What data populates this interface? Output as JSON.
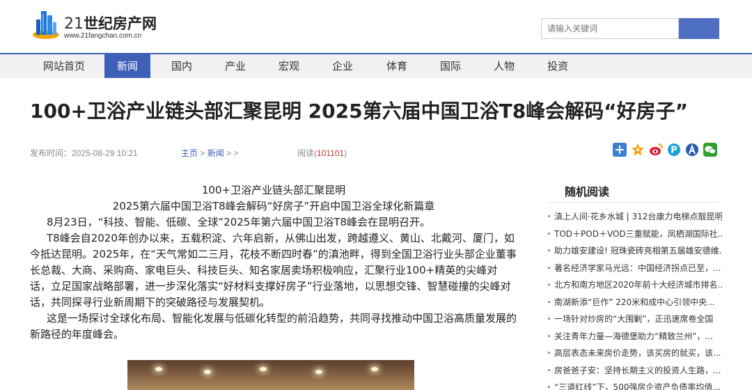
{
  "header": {
    "logo_num": "21",
    "logo_name": "世纪房产网",
    "logo_url": "www.21fangchan.com.cn",
    "search_placeholder": "请输入关键词",
    "brand_color": "#3d5fb8"
  },
  "nav": {
    "items": [
      {
        "label": "网站首页",
        "active": false
      },
      {
        "label": "新闻",
        "active": true
      },
      {
        "label": "国内",
        "active": false
      },
      {
        "label": "产业",
        "active": false
      },
      {
        "label": "宏观",
        "active": false
      },
      {
        "label": "企业",
        "active": false
      },
      {
        "label": "体育",
        "active": false
      },
      {
        "label": "国际",
        "active": false
      },
      {
        "label": "人物",
        "active": false
      },
      {
        "label": "投资",
        "active": false
      }
    ]
  },
  "article": {
    "title": "100+卫浴产业链头部汇聚昆明 2025第六届中国卫浴T8峰会解码“好房子”",
    "publish_label": "发布时间：2025-08-29 10:21",
    "breadcrumb_home": "主页",
    "breadcrumb_sep1": " > ",
    "breadcrumb_news": "新闻",
    "breadcrumb_sep2": " > >",
    "read_label": "阅读(",
    "read_count": "101101",
    "read_close": ")",
    "subtitle1": "100+卫浴产业链头部汇聚昆明",
    "subtitle2": "2025第六届中国卫浴T8峰会解码“好房子”开启中国卫浴全球化新篇章",
    "para1": "8月23日，“科技、智能、低碳、全球”2025年第六届中国卫浴T8峰会在昆明召开。",
    "para2": "T8峰会自2020年创办以来，五载积淀、六年启新，从佛山出发，跨越遵义、黄山、北戴河、厦门，如今抵达昆明。2025年，在“天气常如二三月，花枝不断四时春”的滇池畔，得到全国卫浴行业头部企业董事长总裁、大商、采购商、家电巨头、科技巨头、知名家居卖场积极响应，汇聚行业100+精英的尖峰对话，立足国家战略部署，进一步深化落实“好材料支撑好房子”行业落地，以思想交锋、智慧碰撞的尖峰对话，共同探寻行业新周期下的突破路径与发展契机。",
    "para3": "这是一场探讨全球化布局、智能化发展与低碳化转型的前沿趋势，共同寻找推动中国卫浴高质量发展的新路径的年度峰会。"
  },
  "share": {
    "icons": [
      {
        "name": "plus-share-icon",
        "glyph": "+",
        "color": "#3b7fd1"
      },
      {
        "name": "star-share-icon",
        "glyph": "★",
        "color": "#f2a007"
      },
      {
        "name": "weibo-share-icon",
        "glyph": "微",
        "color": "#e6162d"
      },
      {
        "name": "p-share-icon",
        "glyph": "P",
        "color": "#1aa0dd"
      },
      {
        "name": "person-share-icon",
        "glyph": "人",
        "color": "#2b5bb0"
      },
      {
        "name": "wechat-share-icon",
        "glyph": "微",
        "color": "#2ca02c"
      }
    ]
  },
  "sidebar": {
    "title": "随机阅读",
    "items": [
      "滇上人间·花乡水城 | 312台康力电梯点靓昆明...",
      "TOD＋POD＋VOD三重赋能，凤栖湖国际社...",
      "助力雄安建设! 冠珠瓷砖亮相第五届雄安德维...",
      "著名经济学家马光远：中国经济拐点已至，...",
      "北方和南方地区2020年前十大经济城市排名...",
      "南湖新添“巨作” 220米和成中心引领中央...",
      "一场针对炒房的“大围剿”，正迅速席卷全国",
      "关注青年力量—海德堡助力“精致兰州”，...",
      "高层表态未来房价走势，该买房的就买，该...",
      "房爸爸子安：坚持长期主义的投资人生路，...",
      "“三道红线”下，500强房企资产负债率均值..."
    ]
  }
}
